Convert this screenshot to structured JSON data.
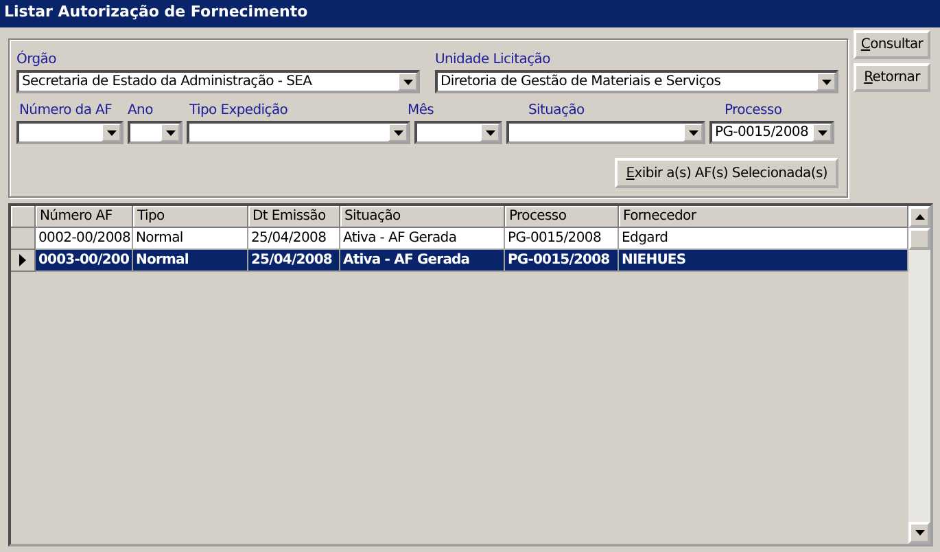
{
  "window": {
    "title": "Listar Autorização de Fornecimento"
  },
  "filters": {
    "orgao": {
      "label": "Órgão",
      "value": "Secretaria de Estado da Administração - SEA"
    },
    "unidade": {
      "label": "Unidade Licitação",
      "value": "Diretoria de Gestão de Materiais e Serviços"
    },
    "row2": [
      {
        "label": "Número da AF"
      },
      {
        "label": "Ano"
      },
      {
        "label": "Tipo Expedição"
      },
      {
        "label": "Mês"
      },
      {
        "label": "Situação"
      },
      {
        "label": "Processo",
        "value": "PG-0015/2008"
      }
    ]
  },
  "show_button": "Exibir a(s) AF(s) Selecionada(s)",
  "side_buttons": [
    "Consultar",
    "Retornar"
  ],
  "table": {
    "columns": [
      "Número AF",
      "Tipo",
      "Dt Emissão",
      "Situação",
      "Processo",
      "Fornecedor"
    ],
    "rows": [
      {
        "cells": [
          "0002-00/2008",
          "Normal",
          "25/04/2008",
          "Ativa - AF Gerada",
          "PG-0015/2008",
          "Edgard"
        ],
        "selected": false
      },
      {
        "cells": [
          "0003-00/200",
          "Normal",
          "25/04/2008",
          "Ativa - AF Gerada",
          "PG-0015/2008",
          "NIEHUES"
        ],
        "selected": true
      }
    ]
  }
}
